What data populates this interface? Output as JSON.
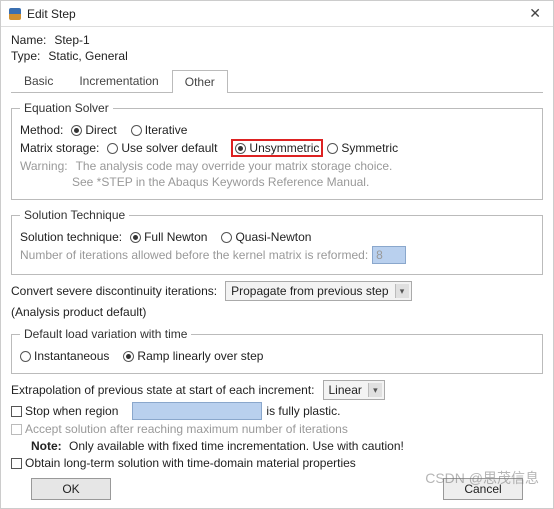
{
  "window": {
    "title": "Edit Step"
  },
  "header": {
    "name_label": "Name:",
    "name_value": "Step-1",
    "type_label": "Type:",
    "type_value": "Static, General"
  },
  "tabs": {
    "basic": "Basic",
    "incrementation": "Incrementation",
    "other": "Other",
    "active": "other"
  },
  "solver": {
    "legend": "Equation Solver",
    "method_label": "Method:",
    "method_direct": "Direct",
    "method_iterative": "Iterative",
    "storage_label": "Matrix storage:",
    "storage_default": "Use solver default",
    "storage_unsym": "Unsymmetric",
    "storage_sym": "Symmetric",
    "warning_label": "Warning:",
    "warning_line1": "The analysis code may override your matrix storage choice.",
    "warning_line2": "See *STEP in the Abaqus Keywords Reference Manual."
  },
  "technique": {
    "legend": "Solution Technique",
    "label": "Solution technique:",
    "full": "Full Newton",
    "quasi": "Quasi-Newton",
    "iter_label": "Number of iterations allowed before the kernel matrix is reformed:",
    "iter_value": "8"
  },
  "discontinuity": {
    "label": "Convert severe discontinuity iterations:",
    "value": "Propagate from previous step",
    "suffix": "(Analysis product default)"
  },
  "loadvar": {
    "legend": "Default load variation with time",
    "instant": "Instantaneous",
    "ramp": "Ramp linearly over step"
  },
  "extrap": {
    "label": "Extrapolation of previous state at start of each increment:",
    "value": "Linear"
  },
  "plastic": {
    "prefix": "Stop when region",
    "suffix": "is fully plastic.",
    "region_value": ""
  },
  "accept": {
    "label": "Accept solution after reaching maximum number of iterations"
  },
  "note": {
    "label": "Note:",
    "text": "Only available with fixed time incrementation. Use with caution!"
  },
  "longterm": {
    "label": "Obtain long-term solution with time-domain material properties"
  },
  "buttons": {
    "ok": "OK",
    "cancel": "Cancel"
  },
  "watermark": "CSDN @思茂信息"
}
